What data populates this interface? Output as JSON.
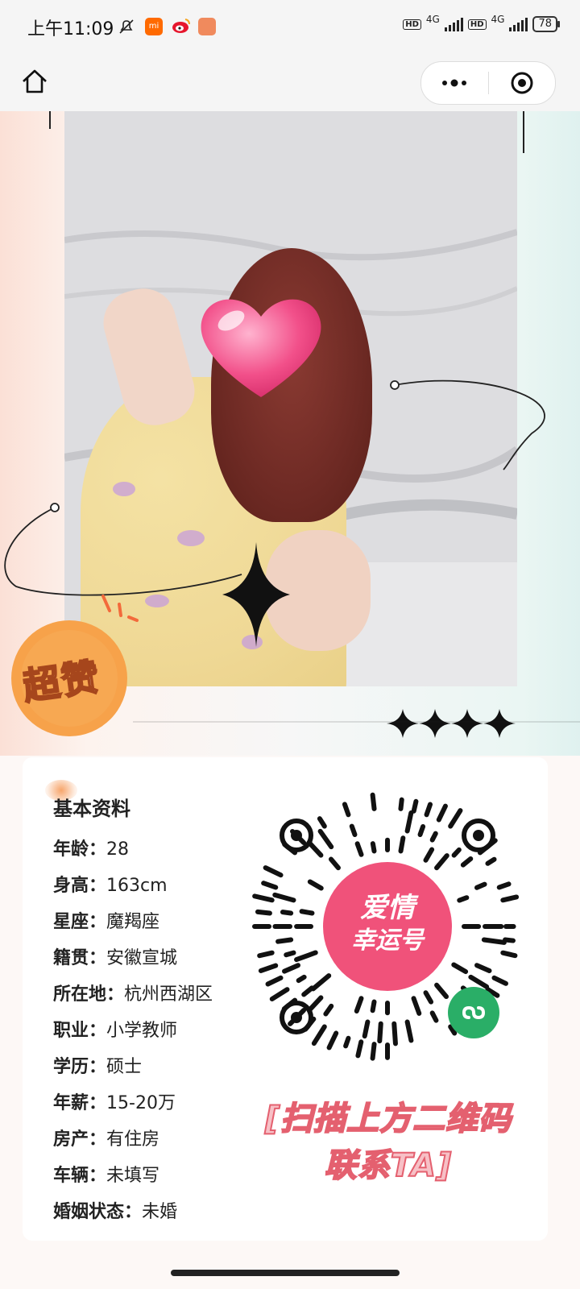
{
  "status_bar": {
    "time": "上午11:09",
    "network_1": "4G",
    "network_2": "4G",
    "hd_1": "HD",
    "hd_2": "HD",
    "battery": "78",
    "icon_colors": {
      "mi": "#ff6a00",
      "weibo": "#e6162d",
      "app": "#f08a5d"
    }
  },
  "nav": {
    "home_icon": "home-icon",
    "more_icon": "more-dots-icon",
    "close_icon": "target-close-icon"
  },
  "hero": {
    "badge_text": "超赞",
    "badge_color": "#f7a24a",
    "photo_alt": "photo"
  },
  "profile": {
    "section_title": "基本资料",
    "fields": [
      {
        "label": "年龄：",
        "value": "28"
      },
      {
        "label": "身高：",
        "value": "163cm"
      },
      {
        "label": "星座：",
        "value": "魔羯座"
      },
      {
        "label": "籍贯：",
        "value": "安徽宣城"
      },
      {
        "label": "所在地：",
        "value": "杭州西湖区"
      },
      {
        "label": "职业：",
        "value": "小学教师"
      },
      {
        "label": "学历：",
        "value": "硕士"
      },
      {
        "label": "年薪：",
        "value": "15-20万"
      },
      {
        "label": "房产：",
        "value": "有住房"
      },
      {
        "label": "车辆：",
        "value": "未填写"
      },
      {
        "label": "婚姻状态：",
        "value": "未婚"
      }
    ]
  },
  "qr": {
    "center_line_1": "爱情",
    "center_line_2": "幸运号",
    "center_color": "#f0527a"
  },
  "cta": {
    "line_1": "[扫描上方二维码",
    "line_2": "联系TA]"
  }
}
